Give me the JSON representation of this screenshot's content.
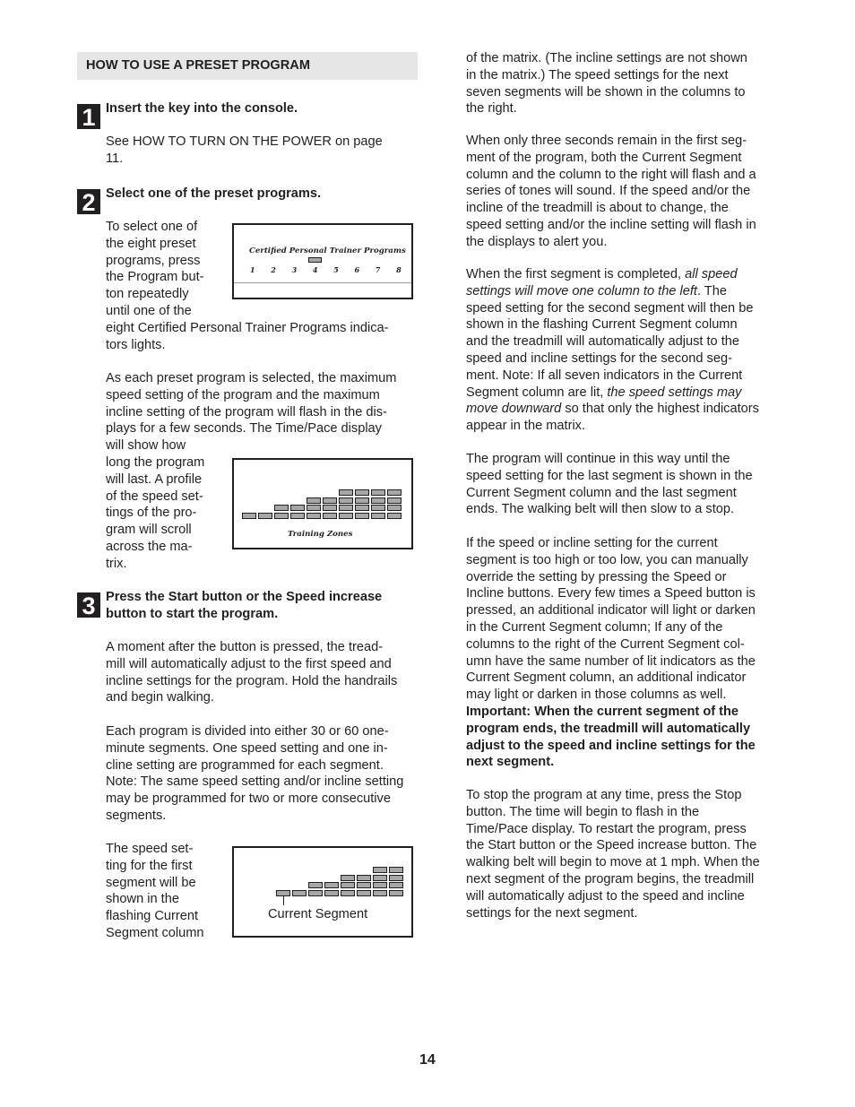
{
  "section_title": "HOW TO USE A PRESET PROGRAM",
  "page_number": "14",
  "steps": [
    {
      "number": "1",
      "heading": [
        "Insert the key into the console."
      ],
      "body": [
        "See HOW TO TURN ON THE POWER on page",
        "11."
      ]
    },
    {
      "number": "2",
      "heading": [
        "Select one of the preset programs."
      ],
      "para1": [
        "To select one of",
        "the eight preset",
        "programs, press",
        "the Program but-",
        "ton repeatedly",
        "until one of the",
        "eight Certified Personal Trainer Programs indica-",
        "tors lights."
      ],
      "para2": [
        "As each preset program is selected, the maximum",
        "speed setting of the program and the maximum",
        "incline setting of the program will flash in the dis-",
        "plays for a few seconds. The Time/Pace display",
        "will show how",
        "long the program",
        "will last. A profile",
        "of the speed set-",
        "tings of the pro-",
        "gram will scroll",
        "across the ma-",
        "trix."
      ]
    },
    {
      "number": "3",
      "heading": [
        "Press the Start button or the Speed increase",
        "button to start the program."
      ],
      "para1": [
        "A moment after the button is pressed, the tread-",
        "mill will automatically adjust to the first speed and",
        "incline settings for the program. Hold the handrails",
        "and begin walking."
      ],
      "para2": [
        "Each program is divided into either 30 or 60 one-",
        "minute segments. One speed setting and one in-",
        "cline setting are programmed for each segment.",
        "Note: The same speed setting and/or incline setting",
        "may be programmed for two or more consecutive",
        "segments."
      ],
      "para3": [
        "The speed set-",
        "ting for the first",
        "segment will be",
        "shown in the",
        "flashing Current",
        "Segment column"
      ]
    }
  ],
  "right_column": {
    "p1": [
      "of the matrix. (The incline settings are not shown",
      "in the matrix.) The speed settings for the next",
      "seven segments will be shown in the columns to",
      "the right."
    ],
    "p2": [
      "When only three seconds remain in the first seg-",
      "ment of the program, both the Current Segment",
      "column and the column to the right will flash and a",
      "series of tones will sound. If the speed and/or the",
      "incline of the treadmill is about to change, the",
      "speed setting and/or the incline setting will flash in",
      "the displays to alert you."
    ],
    "p3": {
      "l1_normal": "When the first segment is completed, ",
      "l1_italic": "all speed",
      "l2_italic": "settings will move one column to the left",
      "l2_normal": ". The",
      "lines_mid": [
        "speed setting for the second segment will then be",
        "shown in the flashing Current Segment column",
        "and the treadmill will automatically adjust to the",
        "speed and incline settings for the second seg-",
        "ment. Note: If all seven indicators in the Current"
      ],
      "l8_normal": "Segment column are lit, ",
      "l8_italic": "the speed settings may",
      "l9_italic": "move downward",
      "l9_normal": " so that only the highest indicators",
      "l10": "appear in the matrix."
    },
    "p4": [
      "The program will continue in this way until the",
      "speed setting for the last segment is shown in the",
      "Current Segment column and the last segment",
      "ends. The walking belt will then slow to a stop."
    ],
    "p5": [
      "If the speed or incline setting for the current",
      "segment is too high or too low, you can manually",
      "override the setting by pressing the Speed or",
      "Incline buttons. Every few times a Speed button is",
      "pressed, an additional indicator will light or darken",
      "in the Current Segment column; If any of the",
      "columns to the right of the Current Segment col-",
      "umn have the same number of lit indicators as the",
      "Current Segment column, an additional indicator",
      "may light or darken in those columns as well."
    ],
    "p5_bold": [
      "Important: When the current segment of the",
      "program ends, the treadmill will automatically",
      "adjust to the speed and incline settings for the",
      "next segment."
    ],
    "p6": [
      "To stop the program at any time, press the Stop",
      "button. The time will begin to flash in the",
      "Time/Pace display. To restart the program, press",
      "the Start button or the Speed increase button. The",
      "walking belt will begin to move at 1 mph. When the",
      "next segment of the program begins, the treadmill",
      "will automatically adjust to the speed and incline",
      "settings for the next segment."
    ]
  },
  "figures": {
    "programs_panel": {
      "title": "Certified Personal Trainer Programs",
      "numbers": [
        "1",
        "2",
        "3",
        "4",
        "5",
        "6",
        "7",
        "8"
      ],
      "selected": "4"
    },
    "training_zones_panel": {
      "label": "Training Zones",
      "column_heights": [
        1,
        1,
        2,
        2,
        3,
        3,
        4,
        4,
        4,
        4
      ]
    },
    "current_segment_panel": {
      "label": "Current Segment",
      "column_heights": [
        1,
        1,
        2,
        2,
        3,
        3,
        4,
        4
      ]
    }
  }
}
